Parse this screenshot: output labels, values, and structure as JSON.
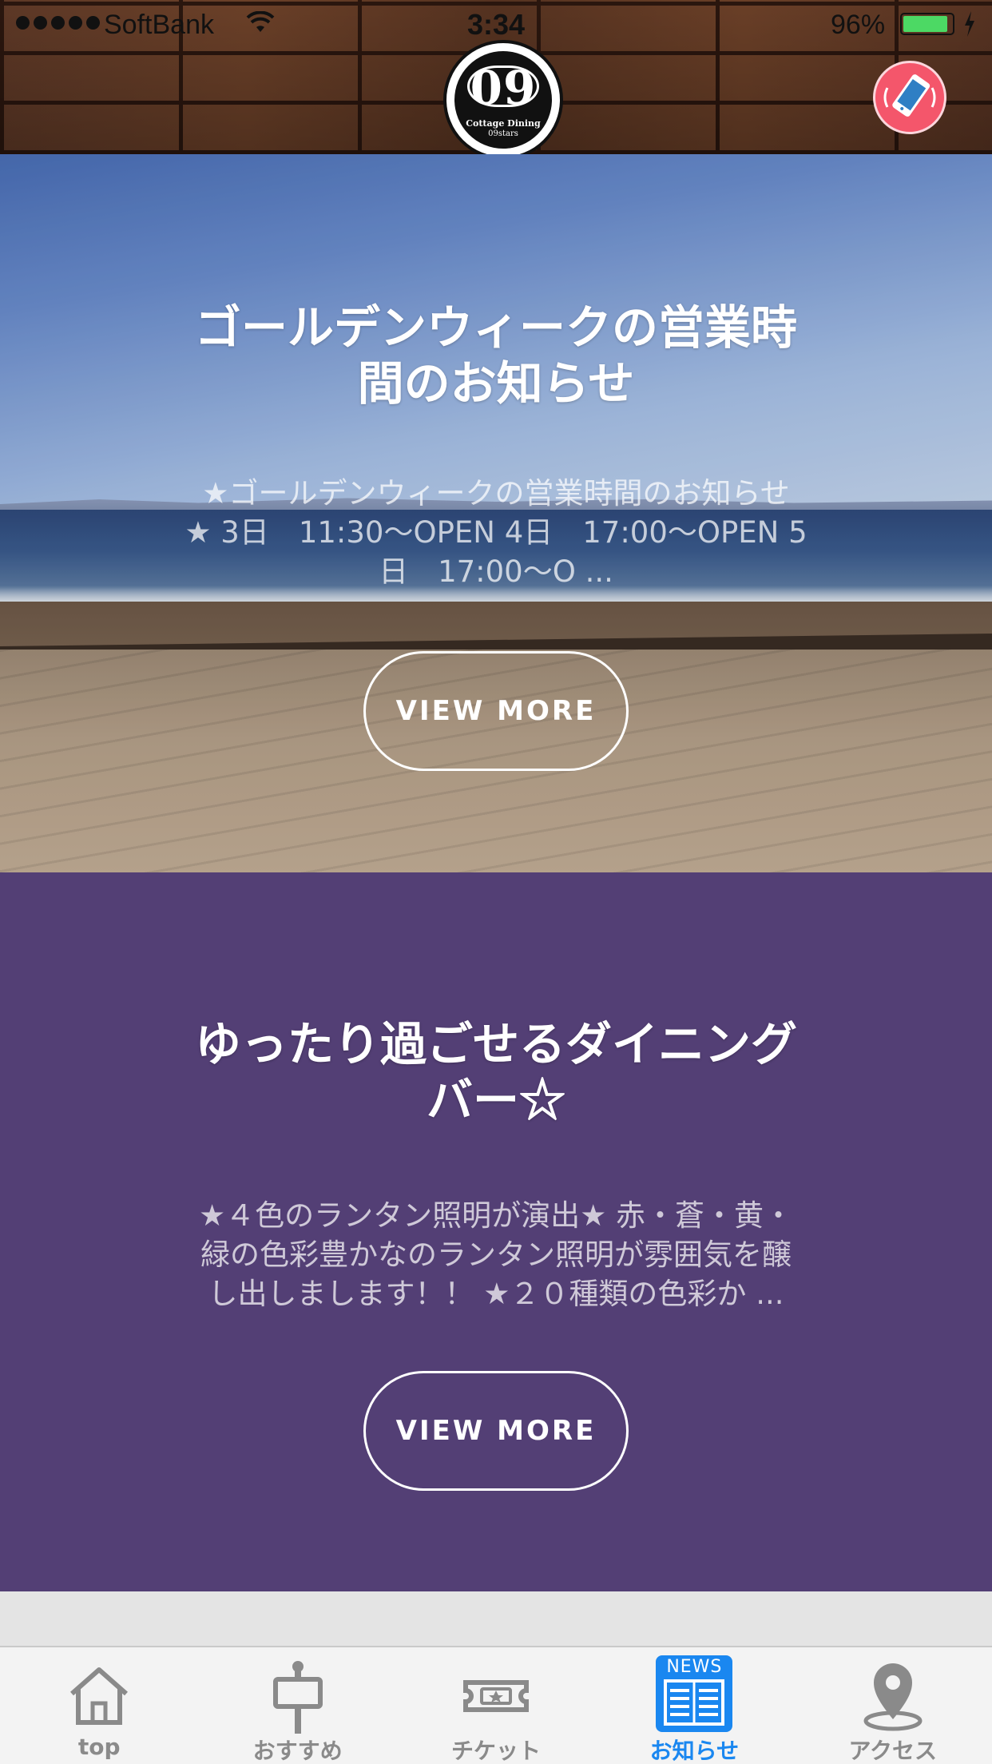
{
  "status_bar": {
    "carrier": "SoftBank",
    "time": "3:34",
    "battery": "96%",
    "battery_level": 0.96
  },
  "header": {
    "logo": {
      "number": "09",
      "arc_text": "Cottage Dining 09stars",
      "sub_text": "Cottage Dining",
      "sub_text_2": "09stars"
    },
    "call_icon": "phone-ringing-icon"
  },
  "cards": [
    {
      "title": "ゴールデンウィークの営業時間のお知らせ",
      "title_line1": "ゴールデンウィークの営業時",
      "title_line2": "間のお知らせ",
      "body_line1": "★ゴールデンウィークの営業時間のお知らせ",
      "body_line2": "★ 3日　11:30〜OPEN 4日　17:00〜OPEN 5",
      "body_line3": "日　17:00〜O ...",
      "button": "VIEW MORE"
    },
    {
      "title_line1": "ゆったり過ごせるダイニング",
      "title_line2": "バー☆",
      "body_line1": "★４色のランタン照明が演出★ 赤・蒼・黄・",
      "body_line2": "緑の色彩豊かなのランタン照明が雰囲気を醸",
      "body_line3": "し出しまします！！ ★２０種類の色彩か ...",
      "button": "VIEW MORE",
      "background": "#533f75"
    }
  ],
  "tabbar": {
    "items": [
      {
        "label": "top",
        "icon": "house-icon"
      },
      {
        "label": "おすすめ",
        "icon": "signboard-icon"
      },
      {
        "label": "チケット",
        "icon": "ticket-icon"
      },
      {
        "label": "お知らせ",
        "icon": "news-icon",
        "badge_text": "NEWS",
        "active": true
      },
      {
        "label": "アクセス",
        "icon": "map-pin-icon"
      }
    ],
    "active_color": "#1a87f0"
  }
}
